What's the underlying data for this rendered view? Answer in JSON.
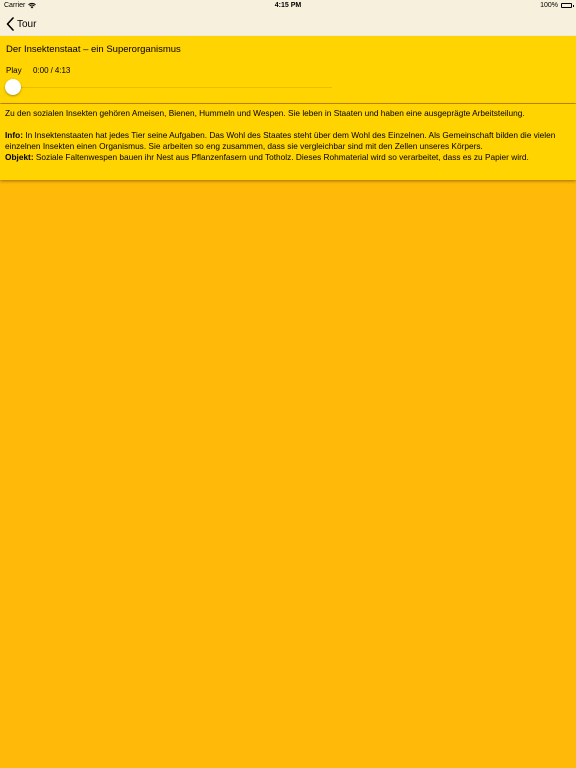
{
  "status_bar": {
    "carrier": "Carrier",
    "time": "4:15 PM",
    "battery_percent": "100%",
    "wifi_icon": "wifi-icon",
    "battery_icon": "battery-icon"
  },
  "nav": {
    "back_label": "Tour",
    "back_icon": "chevron-left-icon"
  },
  "player": {
    "title": "Der Insektenstaat – ein Superorganismus",
    "play_label": "Play",
    "current_time": "0:00",
    "separator": "/",
    "duration": "4:13",
    "progress": 0
  },
  "text": {
    "intro": "Zu den sozialen Insekten gehören Ameisen, Bienen, Hummeln und Wespen. Sie leben in Staaten und haben eine ausgeprägte Arbeitsteilung.",
    "info_label": "Info:",
    "info_text": " In Insektenstaaten hat jedes Tier seine Aufgaben. Das Wohl des Staates steht über dem Wohl des Einzelnen. Als Gemeinschaft bilden die vielen einzelnen Insekten einen Organismus. Sie arbeiten so eng zusammen, dass sie vergleichbar sind mit den Zellen unseres Körpers.",
    "object_label": "Objekt:",
    "object_text": " Soziale Faltenwespen bauen ihr Nest aus Pflanzenfasern und Totholz. Dieses Rohmaterial wird so verarbeitet, dass es zu Papier wird."
  },
  "colors": {
    "background": "#ffb908",
    "card": "#ffd400",
    "bar": "#f7f0dc"
  }
}
